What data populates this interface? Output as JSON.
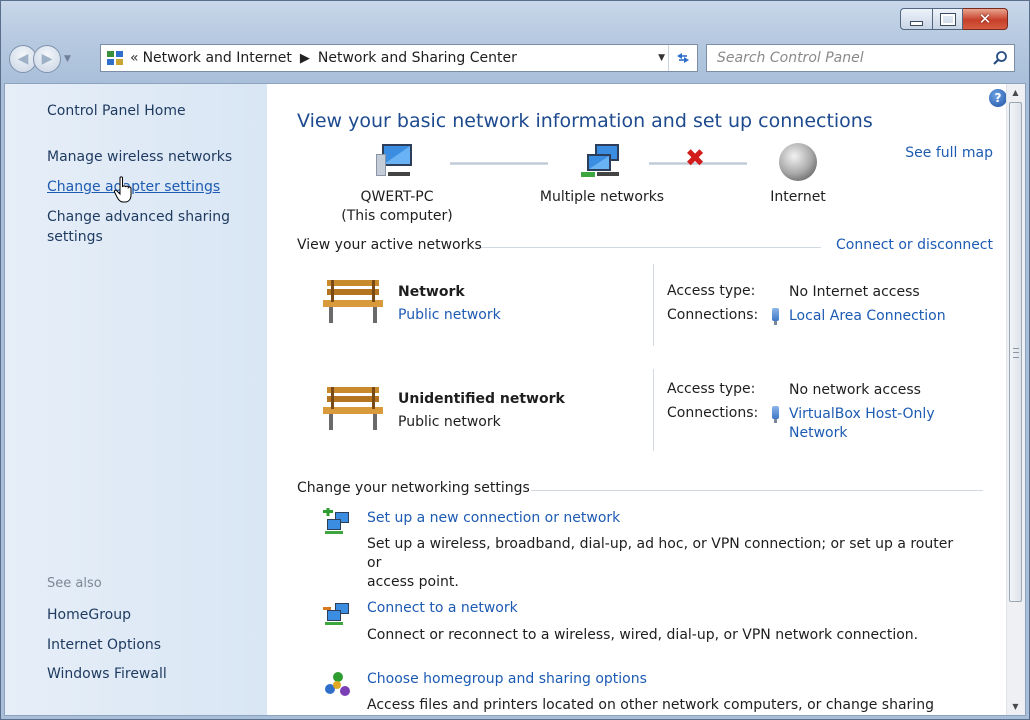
{
  "window": {
    "controls": {
      "minimize": "minimize",
      "maximize": "maximize",
      "close": "✕"
    }
  },
  "address_bar": {
    "overflow": "«",
    "crumbs": [
      "Network and Internet",
      "Network and Sharing Center"
    ]
  },
  "search": {
    "placeholder": "Search Control Panel"
  },
  "sidebar": {
    "links": [
      "Control Panel Home",
      "Manage wireless networks",
      "Change adapter settings",
      "Change advanced sharing settings"
    ],
    "see_also_heading": "See also",
    "see_also": [
      "HomeGroup",
      "Internet Options",
      "Windows Firewall"
    ]
  },
  "main": {
    "title": "View your basic network information and set up connections",
    "see_full_map": "See full map",
    "map": {
      "computer_name": "QWERT-PC",
      "computer_sub": "(This computer)",
      "networks": "Multiple networks",
      "internet": "Internet"
    },
    "active_heading": "View your active networks",
    "connect_link": "Connect or disconnect",
    "networks": [
      {
        "name": "Network",
        "category": "Public network",
        "access_label": "Access type:",
        "access_value": "No Internet access",
        "connections_label": "Connections:",
        "connection_value": "Local Area Connection"
      },
      {
        "name": "Unidentified network",
        "category": "Public network",
        "access_label": "Access type:",
        "access_value": "No network access",
        "connections_label": "Connections:",
        "connection_value_1": "VirtualBox Host-Only",
        "connection_value_2": "Network"
      }
    ],
    "settings_heading": "Change your networking settings",
    "tasks": [
      {
        "title": "Set up a new connection or network",
        "desc_1": "Set up a wireless, broadband, dial-up, ad hoc, or VPN connection; or set up a router or",
        "desc_2": "access point."
      },
      {
        "title": "Connect to a network",
        "desc_1": "Connect or reconnect to a wireless, wired, dial-up, or VPN network connection."
      },
      {
        "title": "Choose homegroup and sharing options",
        "desc_1": "Access files and printers located on other network computers, or change sharing settings."
      }
    ]
  },
  "colors": {
    "link": "#1d5bb3",
    "title": "#1e4b8f",
    "sidebar_bg": "#dfe9f5",
    "error_x": "#d21b1b"
  }
}
